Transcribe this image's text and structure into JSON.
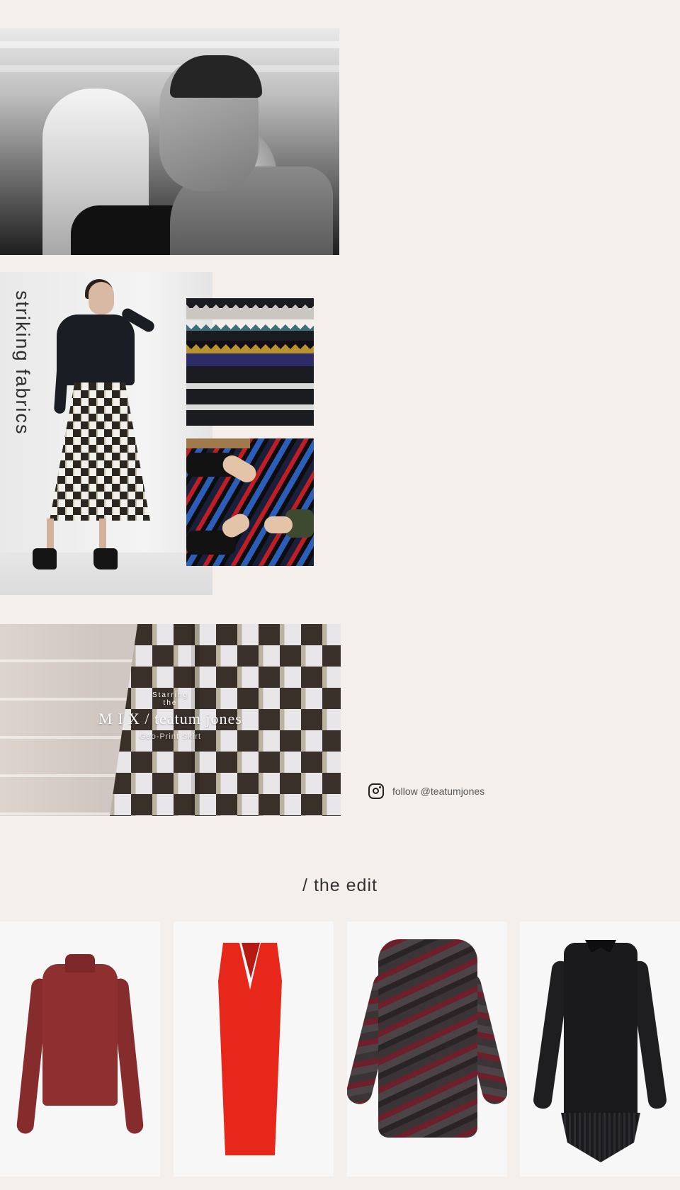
{
  "sections": {
    "fabrics_title": "striking fabrics",
    "edit_title": "/ the edit"
  },
  "feature": {
    "starring_line1": "Starring",
    "starring_line2": "the",
    "brand": "M I X / teatum jones",
    "product": "Geo-Print Skirt"
  },
  "social": {
    "icon": "instagram-icon",
    "follow_label": "follow @teatumjones"
  },
  "images": [
    {
      "name": "designers-photo",
      "alt": "Designers backstage in black and white"
    },
    {
      "name": "model-skirt-photo",
      "alt": "Model wearing black turtleneck and geo-print skirt"
    },
    {
      "name": "fabric-swatch-photo",
      "alt": "Woven fabric swatch with triangle pattern"
    },
    {
      "name": "weaving-hands-photo",
      "alt": "Hands handling red and blue woven fabric"
    },
    {
      "name": "skirt-detail-photo",
      "alt": "Close-up of geo-print skirt"
    }
  ],
  "products": [
    {
      "name": "red turtleneck sweater",
      "color": "#8e2f30"
    },
    {
      "name": "red sleeveless dress",
      "color": "#e8271b"
    },
    {
      "name": "faux fur chevron coat",
      "color": "#4a4446"
    },
    {
      "name": "black shirt dress",
      "color": "#1a1a1c"
    }
  ],
  "colors": {
    "background": "#f4efeb",
    "card_background": "#f8f7f8",
    "text": "#2a2a2a"
  }
}
